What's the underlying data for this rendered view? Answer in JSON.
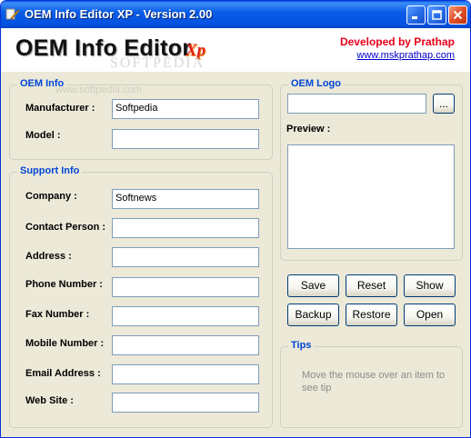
{
  "window": {
    "title": "OEM Info Editor XP - Version 2.00"
  },
  "header": {
    "logo_text": "OEM Info Editor",
    "logo_suffix": "Xp",
    "watermark": "SOFTPEDIA",
    "developer": "Developed by Prathap",
    "url": "www.mskprathap.com"
  },
  "oem_info": {
    "title": "OEM Info",
    "watermark": "www.softpedia.com",
    "manufacturer_label": "Manufacturer :",
    "manufacturer_value": "Softpedia",
    "model_label": "Model :",
    "model_value": ""
  },
  "support_info": {
    "title": "Support Info",
    "company_label": "Company :",
    "company_value": "Softnews",
    "contact_label": "Contact Person :",
    "contact_value": "",
    "address_label": "Address :",
    "address_value": "",
    "phone_label": "Phone Number :",
    "phone_value": "",
    "fax_label": "Fax Number :",
    "fax_value": "",
    "mobile_label": "Mobile Number :",
    "mobile_value": "",
    "email_label": "Email Address :",
    "email_value": "",
    "website_label": "Web Site :",
    "website_value": ""
  },
  "oem_logo": {
    "title": "OEM Logo",
    "path_value": "",
    "browse_label": "...",
    "preview_label": "Preview :"
  },
  "actions": {
    "save": "Save",
    "reset": "Reset",
    "show": "Show",
    "backup": "Backup",
    "restore": "Restore",
    "open": "Open"
  },
  "tips": {
    "title": "Tips",
    "text": "Move the mouse over an item to see tip"
  }
}
